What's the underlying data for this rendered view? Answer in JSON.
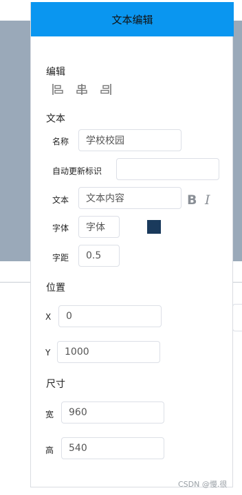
{
  "panel": {
    "title": "文本编辑"
  },
  "edit_section": {
    "title": "编辑",
    "align_buttons": [
      "align-left-icon",
      "align-center-icon",
      "align-right-icon"
    ]
  },
  "text_section": {
    "title": "文本",
    "name_label": "名称",
    "name_value": "学校校园",
    "auto_update_label": "自动更新标识",
    "auto_update_value": "",
    "text_label": "文本",
    "text_value": "文本内容",
    "bold_label": "B",
    "italic_label": "I",
    "font_label": "字体",
    "font_value": "字体",
    "font_color": "#1a3a5c",
    "spacing_label": "字距",
    "spacing_value": "0.5"
  },
  "position_section": {
    "title": "位置",
    "x_label": "X",
    "x_value": "0",
    "y_label": "Y",
    "y_value": "1000"
  },
  "size_section": {
    "title": "尺寸",
    "width_label": "宽",
    "width_value": "960",
    "height_label": "高",
    "height_value": "540"
  },
  "watermark": "CSDN @慢.很",
  "colors": {
    "header": "#0a96f0",
    "backdrop": "#9aa9b9"
  }
}
